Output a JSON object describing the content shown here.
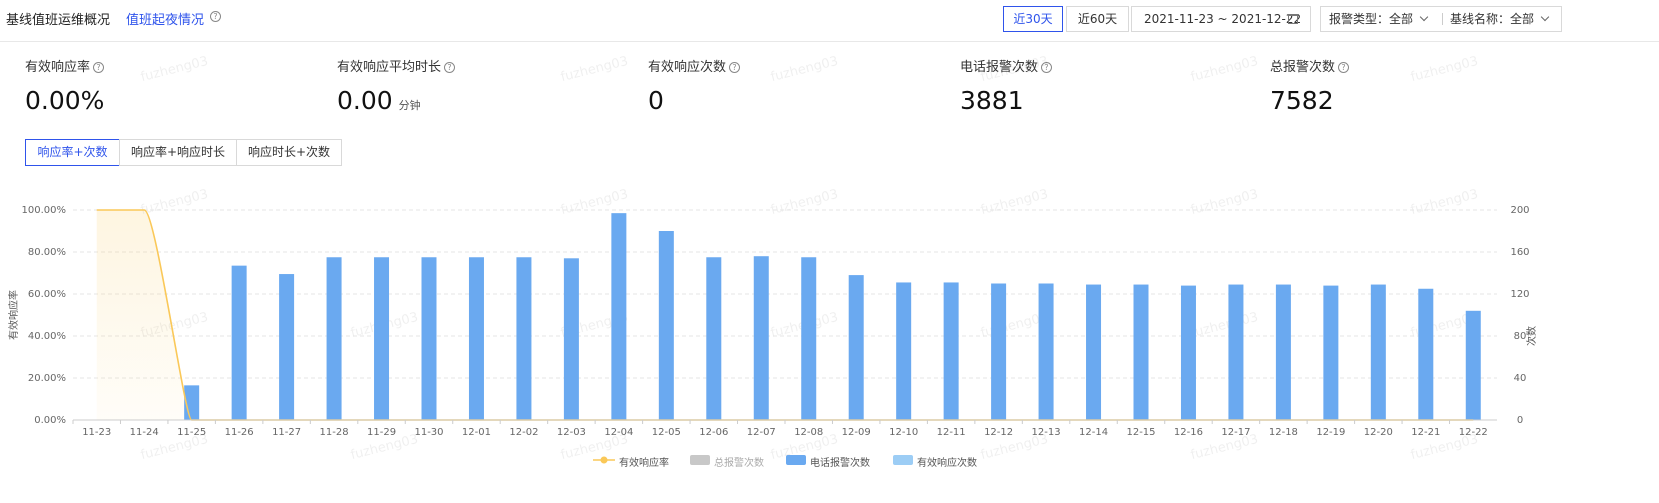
{
  "header": {
    "title": "基线值班运维概况",
    "link": "值班起夜情况",
    "help_icon": "question-circle-icon"
  },
  "time_range": {
    "options": [
      "近30天",
      "近60天"
    ],
    "active": "近30天",
    "date_range": "2021-11-23 ~ 2021-12-22",
    "calendar_icon": "calendar-icon"
  },
  "filters": {
    "alarm_type": "报警类型：全部",
    "baseline_name": "基线名称：全部",
    "dropdown_icon": "chevron-down-icon"
  },
  "stats": [
    {
      "label": "有效响应率",
      "value": "0.00%",
      "unit": ""
    },
    {
      "label": "有效响应平均时长",
      "value": "0.00",
      "unit": "分钟"
    },
    {
      "label": "有效响应次数",
      "value": "0",
      "unit": ""
    },
    {
      "label": "电话报警次数",
      "value": "3881",
      "unit": ""
    },
    {
      "label": "总报警次数",
      "value": "7582",
      "unit": ""
    }
  ],
  "view_tabs": [
    "响应率+次数",
    "响应率+响应时长",
    "响应时长+次数"
  ],
  "active_view_tab": "响应率+次数",
  "watermark_text": "fuzheng03",
  "chart_data": {
    "type": "bar",
    "categories": [
      "11-23",
      "11-24",
      "11-25",
      "11-26",
      "11-27",
      "11-28",
      "11-29",
      "11-30",
      "12-01",
      "12-02",
      "12-03",
      "12-04",
      "12-05",
      "12-06",
      "12-07",
      "12-08",
      "12-09",
      "12-10",
      "12-11",
      "12-12",
      "12-13",
      "12-14",
      "12-15",
      "12-16",
      "12-17",
      "12-18",
      "12-19",
      "12-20",
      "12-21",
      "12-22"
    ],
    "series": [
      {
        "name": "有效响应率",
        "kind": "line",
        "axis": "left",
        "color": "#fac858",
        "values": [
          100,
          100,
          0,
          0,
          0,
          0,
          0,
          0,
          0,
          0,
          0,
          0,
          0,
          0,
          0,
          0,
          0,
          0,
          0,
          0,
          0,
          0,
          0,
          0,
          0,
          0,
          0,
          0,
          0,
          0
        ]
      },
      {
        "name": "总报警次数",
        "kind": "bar",
        "axis": "right",
        "color": "#c8c8c8",
        "values": []
      },
      {
        "name": "电话报警次数",
        "kind": "bar",
        "axis": "right",
        "color": "#6aa9f0",
        "values": [
          0,
          0,
          33,
          147,
          139,
          155,
          155,
          155,
          155,
          155,
          154,
          197,
          180,
          155,
          156,
          155,
          138,
          131,
          131,
          130,
          130,
          129,
          129,
          128,
          129,
          129,
          128,
          129,
          125,
          104
        ]
      },
      {
        "name": "有效响应次数",
        "kind": "bar",
        "axis": "right",
        "color": "#9ccdf5",
        "values": []
      }
    ],
    "y_left": {
      "label": "有效响应率",
      "ticks": [
        "0.00%",
        "20.00%",
        "40.00%",
        "60.00%",
        "80.00%",
        "100.00%"
      ],
      "range": [
        0,
        100
      ]
    },
    "y_right": {
      "label": "次数",
      "ticks": [
        "0",
        "40",
        "80",
        "120",
        "160",
        "200"
      ],
      "range": [
        0,
        200
      ]
    },
    "grid": true,
    "legend_position": "bottom-center"
  }
}
